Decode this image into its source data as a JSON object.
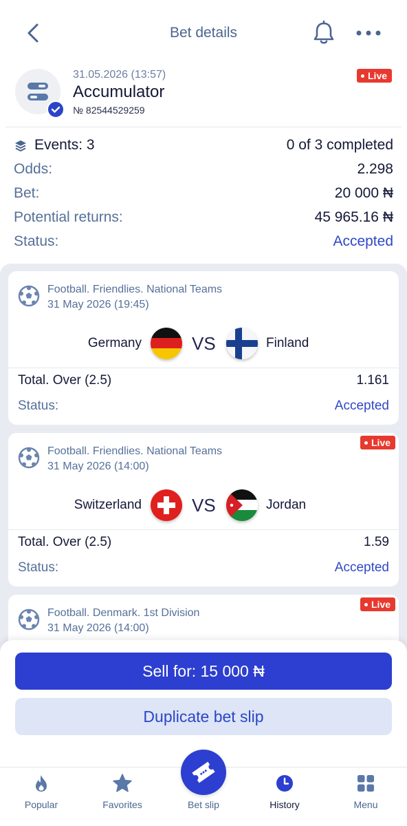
{
  "header": {
    "title": "Bet details",
    "back_icon": "chevron-left-icon",
    "bell_icon": "bell-icon",
    "more_icon": "more-dots-icon"
  },
  "bet": {
    "datetime": "31.05.2026 (13:57)",
    "type": "Accumulator",
    "number": "№ 82544529259",
    "live_label": "Live",
    "events_label": "Events: 3",
    "completed": "0 of 3 completed",
    "odds_label": "Odds:",
    "odds_value": "2.298",
    "bet_label": "Bet:",
    "bet_value": "20 000 ₦",
    "returns_label": "Potential returns:",
    "returns_value": "45 965.16 ₦",
    "status_label": "Status:",
    "status_value": "Accepted"
  },
  "events": [
    {
      "league": "Football. Friendlies. National Teams",
      "date": "31 May 2026 (19:45)",
      "home": "Germany",
      "away": "Finland",
      "vs": "VS",
      "market": "Total. Over (2.5)",
      "odd": "1.161",
      "status_label": "Status:",
      "status_value": "Accepted",
      "live": false
    },
    {
      "league": "Football. Friendlies. National Teams",
      "date": "31 May 2026 (14:00)",
      "home": "Switzerland",
      "away": "Jordan",
      "vs": "VS",
      "market": "Total. Over (2.5)",
      "odd": "1.59",
      "status_label": "Status:",
      "status_value": "Accepted",
      "live": true,
      "live_label": "Live"
    },
    {
      "league": "Football. Denmark. 1st Division",
      "date": "31 May 2026 (14:00)",
      "live": true,
      "live_label": "Live"
    }
  ],
  "actions": {
    "sell_label": "Sell for: 15 000 ₦",
    "duplicate_label": "Duplicate bet slip"
  },
  "tabs": [
    {
      "label": "Popular",
      "icon": "flame-icon"
    },
    {
      "label": "Favorites",
      "icon": "star-icon"
    },
    {
      "label": "Bet slip",
      "icon": "ticket-icon"
    },
    {
      "label": "History",
      "icon": "clock-icon",
      "active": true
    },
    {
      "label": "Menu",
      "icon": "grid-icon"
    }
  ],
  "colors": {
    "accent": "#2c3fd0",
    "live": "#e8392f",
    "muted_text": "#55709a",
    "secondary_button": "#dde5f6"
  }
}
